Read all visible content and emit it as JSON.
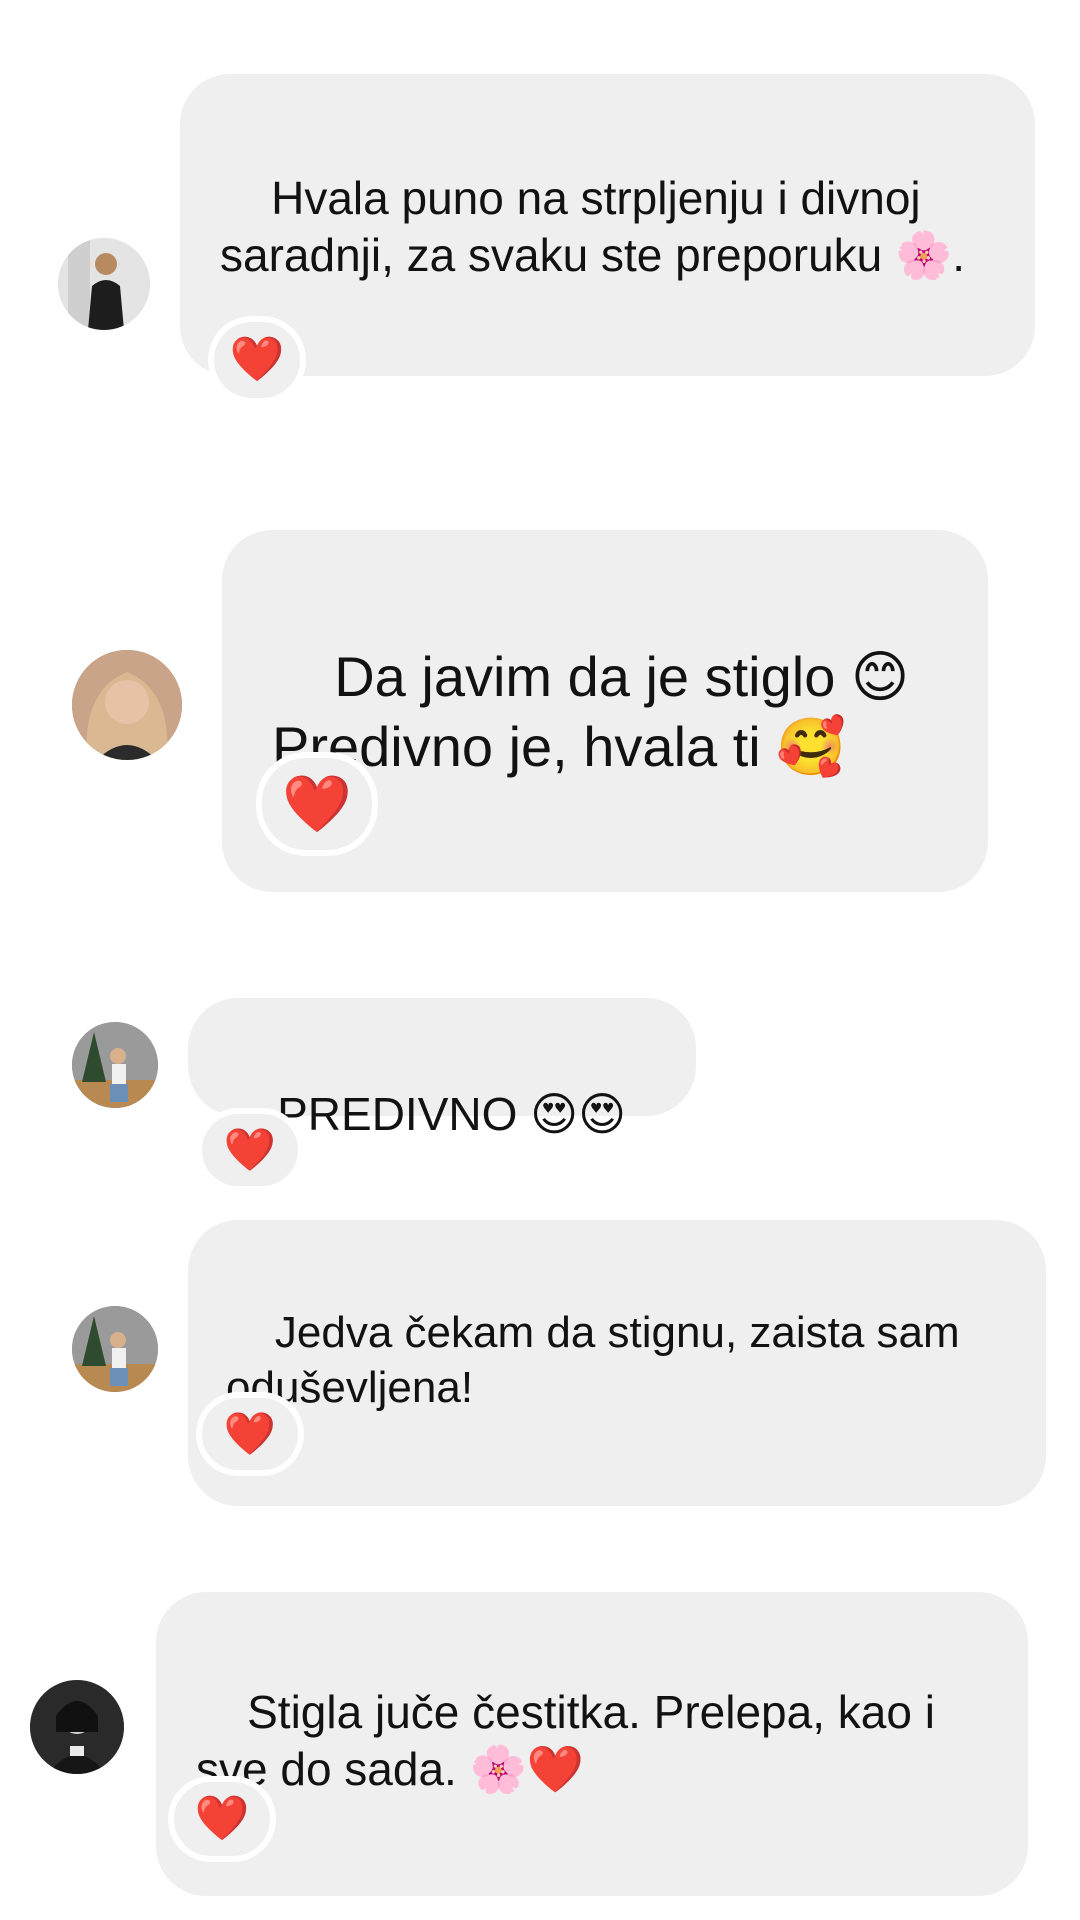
{
  "messages": [
    {
      "text": "Hvala puno na strpljenju i divnoj saradnji, za svaku ste preporuku 🌸.",
      "reaction": "❤️",
      "avatar_icon": "user-avatar-icon"
    },
    {
      "text": "Da javim da je stiglo 😊\nPredivno je, hvala ti 🥰",
      "reaction": "❤️",
      "avatar_icon": "user-avatar-icon"
    },
    {
      "text": "PREDIVNO 😍😍😍",
      "reaction": "❤️",
      "avatar_icon": "user-avatar-icon"
    },
    {
      "text": "Jedva čekam da stignu, zaista sam oduševljena!",
      "reaction": "❤️",
      "avatar_icon": "user-avatar-icon"
    },
    {
      "text": "Stigla juče čestitka. Prelepa, kao i sve do sada. 🌸❤️",
      "reaction": "❤️",
      "avatar_icon": "user-avatar-icon"
    }
  ],
  "colors": {
    "bubble_bg": "#efefef",
    "page_bg": "#ffffff",
    "text": "#121212"
  }
}
